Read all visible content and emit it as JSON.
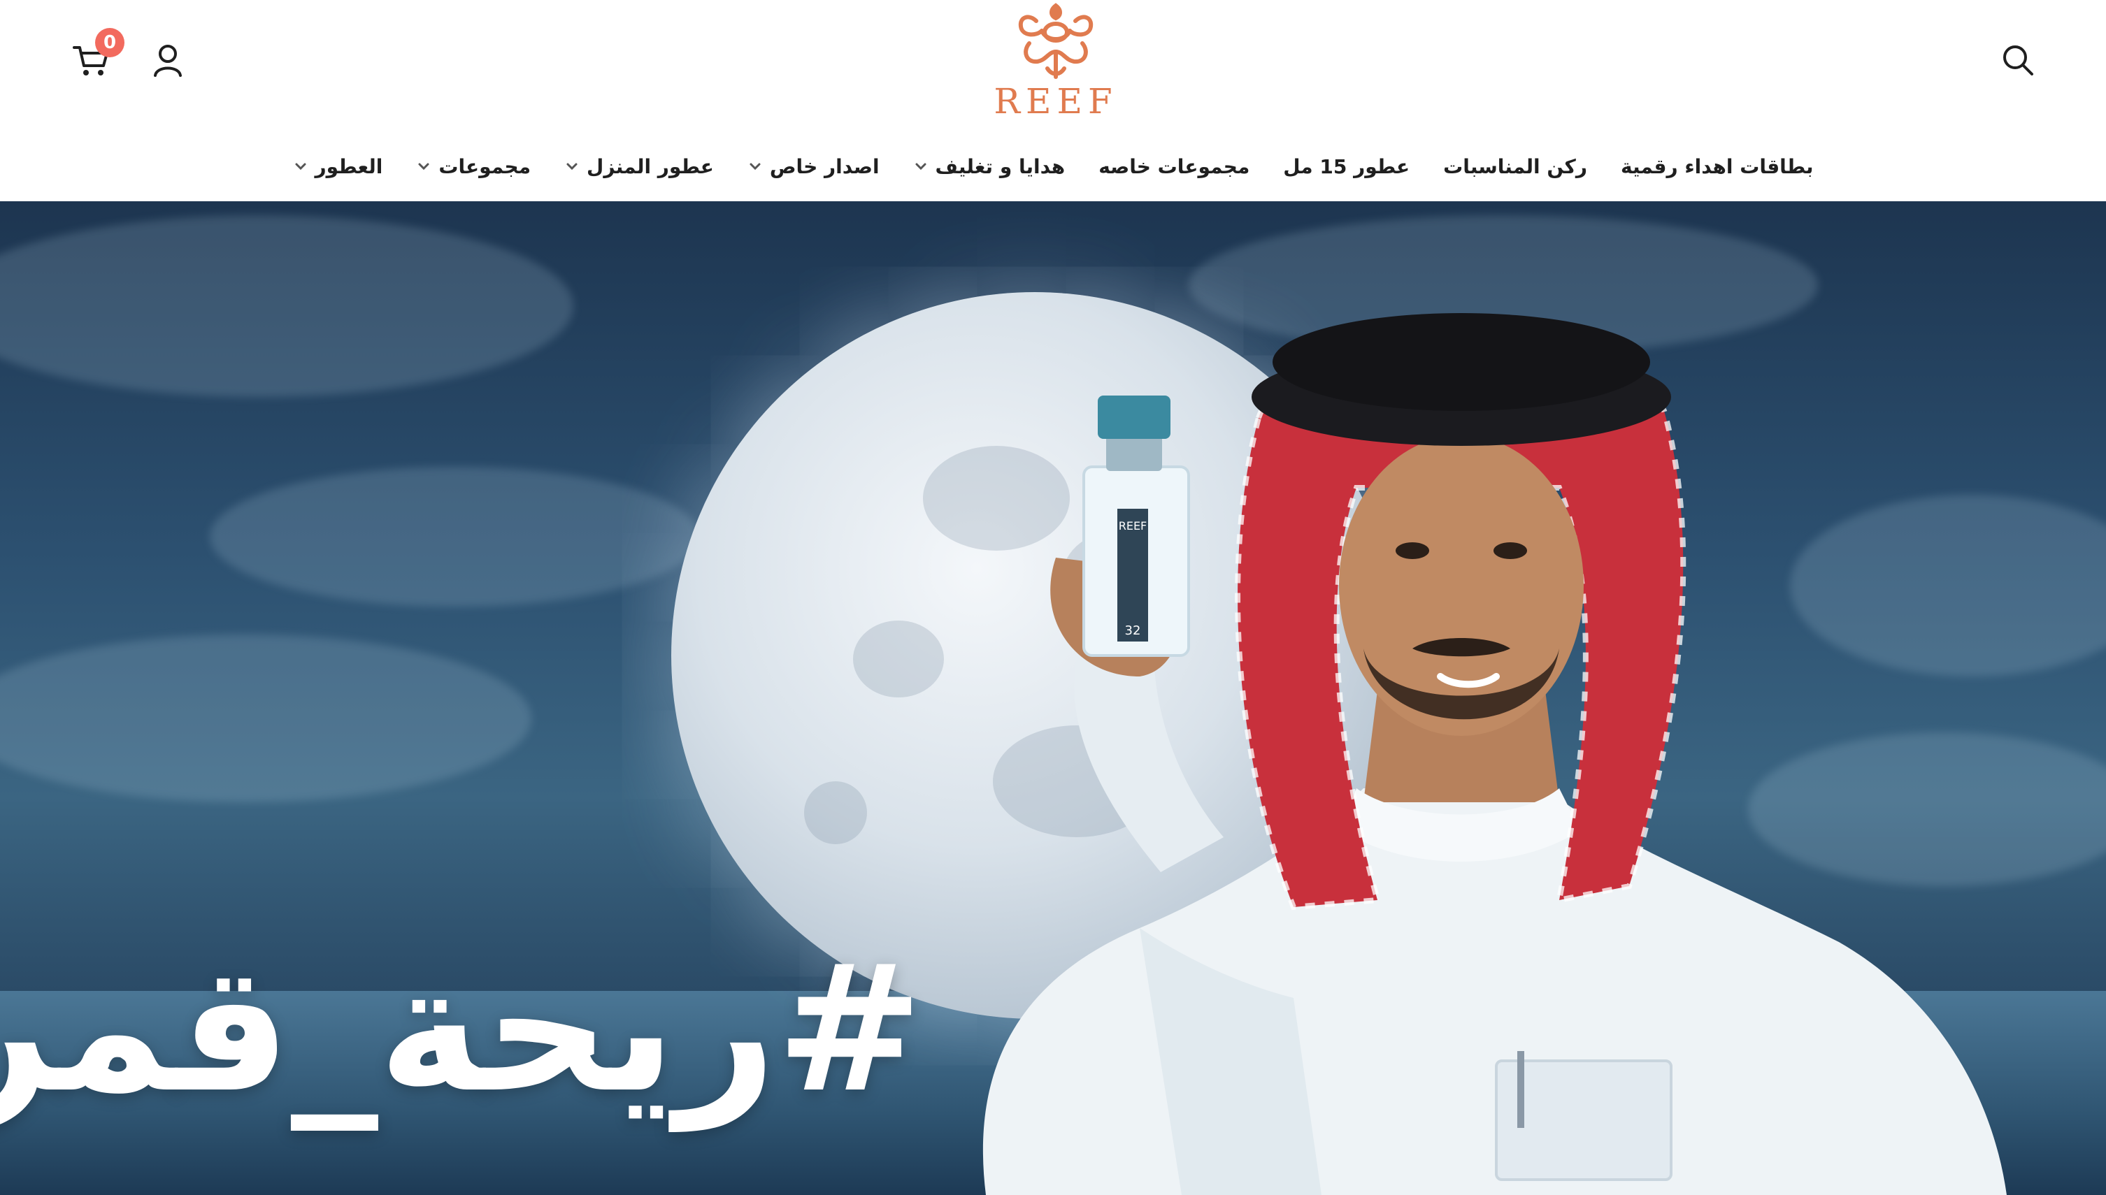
{
  "header": {
    "logo_text": "REEF",
    "cart_count": "0"
  },
  "nav": {
    "items": [
      {
        "label": "العطور",
        "has_dropdown": true
      },
      {
        "label": "مجموعات",
        "has_dropdown": true
      },
      {
        "label": "عطور المنزل",
        "has_dropdown": true
      },
      {
        "label": "اصدار خاص",
        "has_dropdown": true
      },
      {
        "label": "هدايا و تغليف",
        "has_dropdown": true
      },
      {
        "label": "مجموعات خاصه",
        "has_dropdown": false
      },
      {
        "label": "عطور 15 مل",
        "has_dropdown": false
      },
      {
        "label": "ركن المناسبات",
        "has_dropdown": false
      },
      {
        "label": "بطاقات اهداء رقمية",
        "has_dropdown": false
      }
    ]
  },
  "hero": {
    "hashtag": "#ريحة_قمر",
    "bottle_logo": "REEF",
    "bottle_number": "32"
  },
  "colors": {
    "brand": "#e07b4f",
    "cart_badge": "#f26a5e",
    "sky_dark": "#1d3550"
  },
  "icons": [
    "search-icon",
    "user-icon",
    "cart-icon",
    "chevron-down-icon"
  ]
}
